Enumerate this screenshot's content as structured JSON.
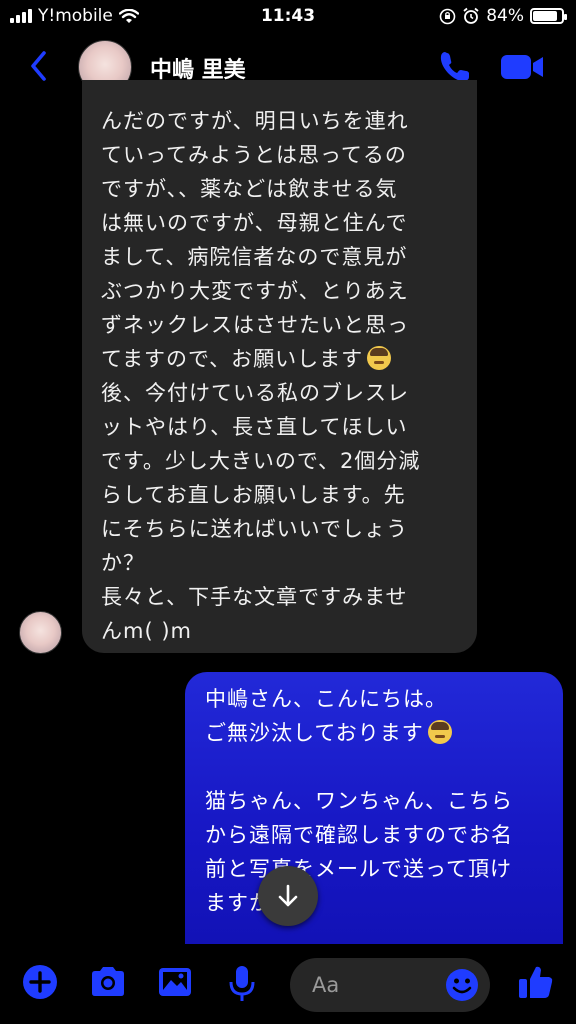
{
  "status_bar": {
    "carrier": "Y!mobile",
    "time": "11:43",
    "battery": "84%",
    "battery_level": 0.84
  },
  "header": {
    "contact_name": "中嶋 里美",
    "icons": [
      "back-chevron-icon",
      "phone-icon",
      "video-camera-icon"
    ]
  },
  "conversation": {
    "incoming": {
      "lines": [
        "んだのですが、明日いちを連れ",
        "ていってみようとは思ってるの",
        "ですが、、薬などは飲ませる気",
        "は無いのですが、母親と住んで",
        "まして、病院信者なので意見が",
        "ぶつかり大変ですが、とりあえ",
        "ずネックレスはさせたいと思っ",
        "てますので、お願いします",
        "後、今付けている私のブレスレ",
        "ットやはり、長さ直してほしい",
        "です。少し大きいので、2個分減",
        "らしてお直しお願いします。先",
        "にそちらに送ればいいでしょう",
        "か？",
        "長々と、下手な文章ですみませ",
        "んm( )m"
      ]
    },
    "outgoing": {
      "lines": [
        "中嶋さん、こんにちは。",
        "ご無沙汰しております",
        "",
        "猫ちゃん、ワンちゃん、こちら",
        "から遠隔で確認しますのでお名",
        "前と写真をメールで送って頂け",
        "ますか"
      ]
    }
  },
  "composer": {
    "placeholder": "Aa",
    "icons": [
      "plus-icon",
      "camera-icon",
      "image-icon",
      "microphone-icon",
      "emoji-icon",
      "thumbs-up-icon"
    ]
  },
  "colors": {
    "accent": "#1f3cff",
    "outgoing_bubble": "#1a1ad0",
    "incoming_bubble": "#262626"
  }
}
